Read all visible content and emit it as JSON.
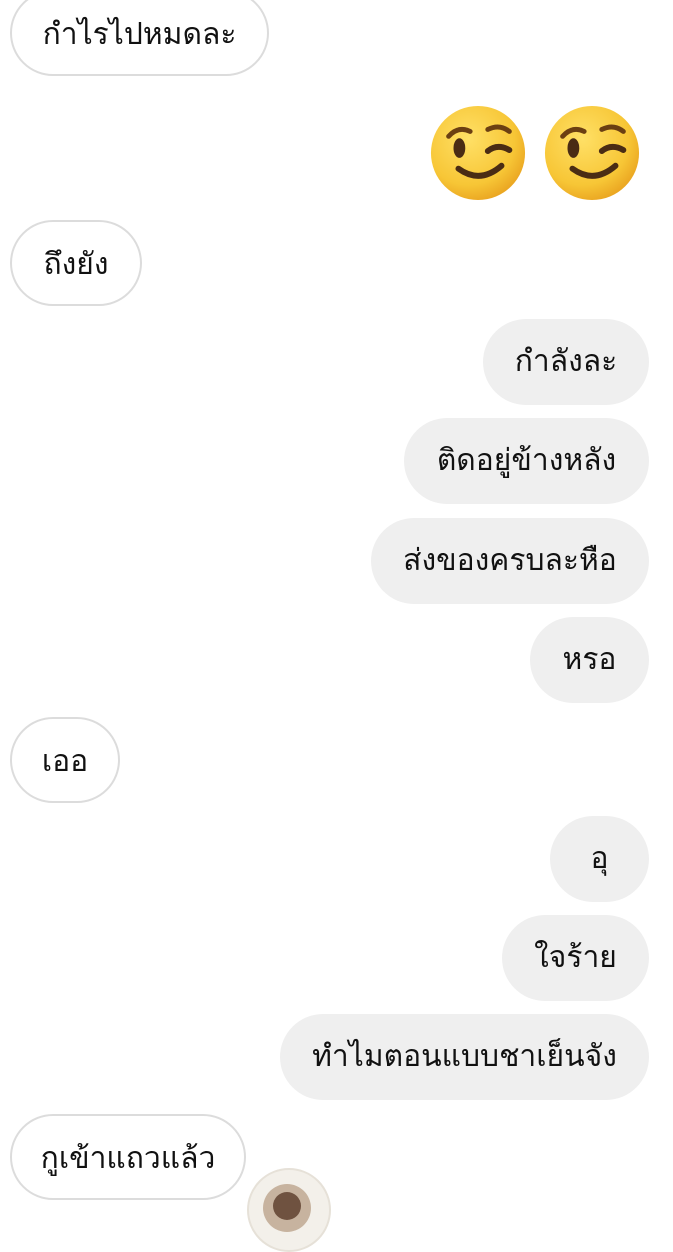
{
  "messages": [
    {
      "text": "กำไรไปหมดละ"
    },
    {
      "emoji": [
        "winking-face",
        "winking-face"
      ]
    },
    {
      "text": "ถึงยัง"
    },
    {
      "text": "กำลังละ"
    },
    {
      "text": "ติดอยู่ข้างหลัง"
    },
    {
      "text": "ส่งของครบละหือ"
    },
    {
      "text": "หรอ"
    },
    {
      "text": "เออ"
    },
    {
      "text": "อุ"
    },
    {
      "text": "ใจร้าย"
    },
    {
      "text": "ทำไมตอนแบบชาเย็นจัง"
    },
    {
      "text": "กูเข้าแถวแล้ว"
    }
  ],
  "colors": {
    "incoming_bubble_border": "#dcdcdc",
    "outgoing_bubble_bg": "#efefef",
    "text": "#111111",
    "emoji_face": "#f7c636"
  }
}
